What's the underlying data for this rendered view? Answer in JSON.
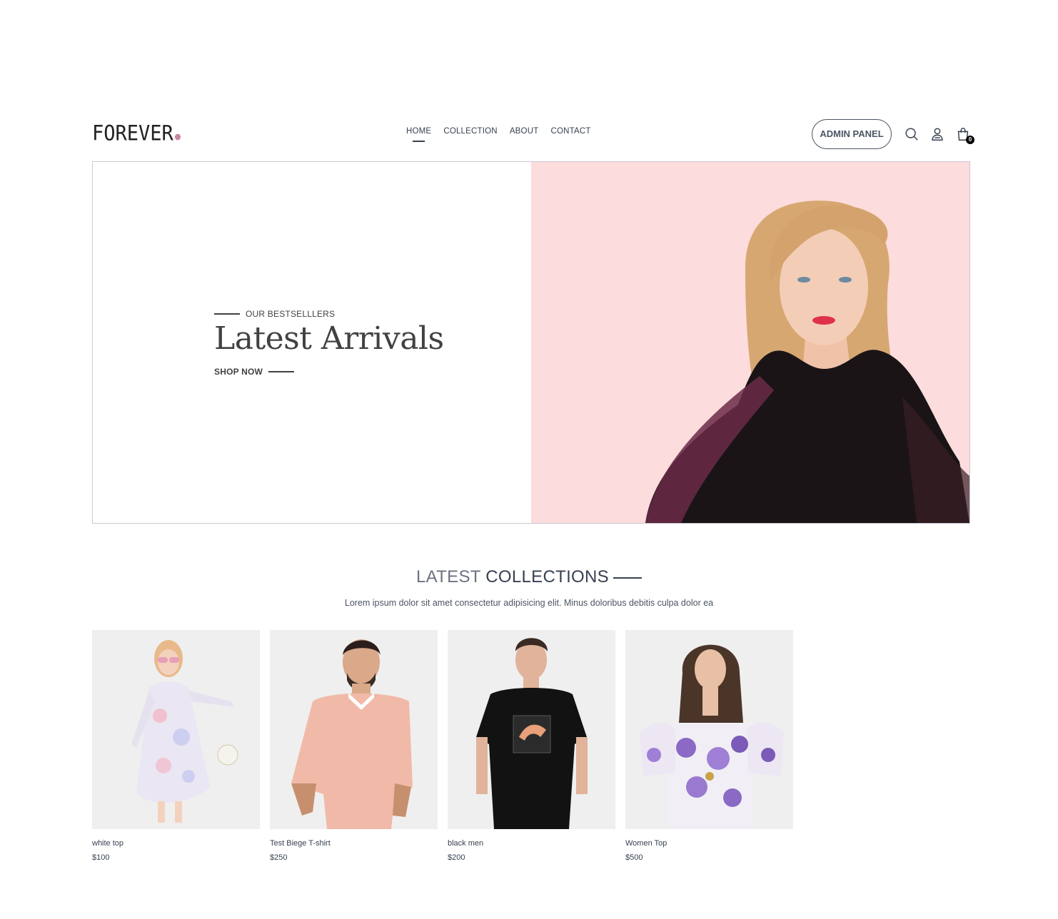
{
  "brand": {
    "name": "FOREVER",
    "dot_color": "#c586a5"
  },
  "nav": {
    "links": [
      "HOME",
      "COLLECTION",
      "ABOUT",
      "CONTACT"
    ],
    "active": "HOME",
    "admin_button": "ADMIN PANEL",
    "icons": [
      "search-icon",
      "profile-icon",
      "cart-icon"
    ],
    "cart_count": "0"
  },
  "hero": {
    "subtitle": "OUR BESTSELLLERS",
    "title": "Latest Arrivals",
    "cta": "SHOP NOW",
    "bg_color": "#fcdcdc"
  },
  "collections": {
    "title_light": "LATEST",
    "title_bold": "COLLECTIONS",
    "description": "Lorem ipsum dolor sit amet consectetur adipisicing elit. Minus doloribus debitis culpa dolor ea",
    "products": [
      {
        "name": "white top",
        "price": "$100"
      },
      {
        "name": "Test Biege T-shirt",
        "price": "$250"
      },
      {
        "name": "black men",
        "price": "$200"
      },
      {
        "name": "Women Top",
        "price": "$500"
      }
    ]
  }
}
